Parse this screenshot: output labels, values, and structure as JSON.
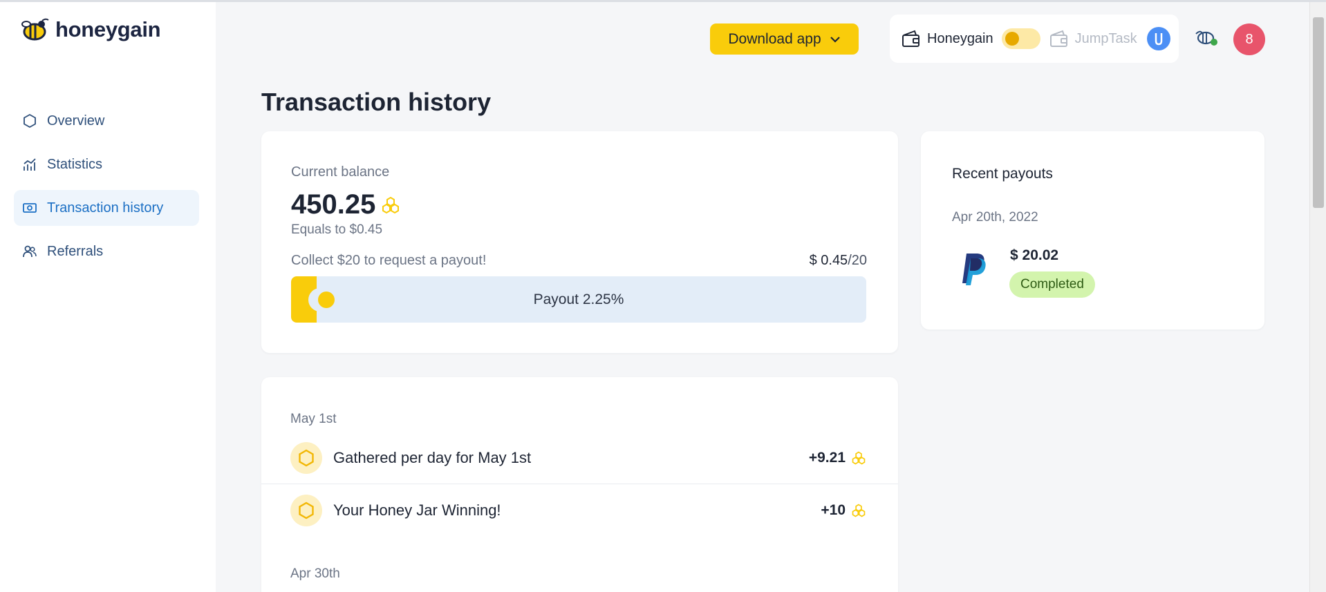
{
  "brand": {
    "name": "honeygain"
  },
  "sidebar": {
    "items": [
      {
        "label": "Overview",
        "icon": "hexagon-icon",
        "active": false
      },
      {
        "label": "Statistics",
        "icon": "bar-chart-icon",
        "active": false
      },
      {
        "label": "Transaction history",
        "icon": "cash-icon",
        "active": true
      },
      {
        "label": "Referrals",
        "icon": "users-icon",
        "active": false
      }
    ]
  },
  "header": {
    "download_label": "Download app",
    "switch_left_label": "Honeygain",
    "switch_right_label": "JumpTask",
    "jt_badge": "J",
    "avatar_initial": "8"
  },
  "page": {
    "title": "Transaction history"
  },
  "balance": {
    "label": "Current balance",
    "value": "450.25",
    "equals": "Equals to $0.45",
    "collect_text": "Collect $20 to request a payout!",
    "target_current": "$ 0.45",
    "target_goal": "/20",
    "progress_label": "Payout 2.25%",
    "progress_fraction": 0.0225
  },
  "payouts": {
    "title": "Recent payouts",
    "items": [
      {
        "date": "Apr 20th, 2022",
        "amount": "$ 20.02",
        "status": "Completed",
        "method": "paypal-logo"
      }
    ]
  },
  "transactions": {
    "groups": [
      {
        "date": "May 1st",
        "items": [
          {
            "description": "Gathered per day for May 1st",
            "amount": "+9.21"
          },
          {
            "description": "Your Honey Jar Winning!",
            "amount": "+10"
          }
        ]
      },
      {
        "date": "Apr 30th",
        "items": []
      }
    ]
  },
  "colors": {
    "accent_yellow": "#f9cc0b",
    "active_blue": "#1b6fc4",
    "avatar_pink": "#e8546b",
    "completed_green": "#d3f4ad"
  }
}
